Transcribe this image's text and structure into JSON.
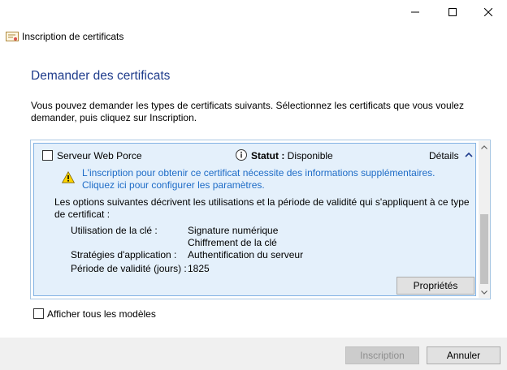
{
  "window": {
    "title": "Inscription de certificats",
    "controls": [
      "minimize-icon",
      "maximize-icon",
      "close-icon"
    ]
  },
  "page": {
    "heading": "Demander des certificats",
    "intro": "Vous pouvez demander les types de certificats suivants. Sélectionnez les certificats que vous voulez demander, puis cliquez sur Inscription."
  },
  "certificate": {
    "name": "Serveur Web Porce",
    "checked": false,
    "status_label": "Statut :",
    "status_value": "Disponible",
    "details_label": "Détails",
    "warning_line1": "L'inscription pour obtenir ce certificat nécessite des informations supplémentaires.",
    "warning_line2": "Cliquez ici pour configurer les paramètres.",
    "description": "Les options suivantes décrivent les utilisations et la période de validité qui s'appliquent à ce type de certificat :",
    "properties": [
      {
        "label": "Utilisation de la clé :",
        "values": [
          "Signature numérique",
          "Chiffrement de la clé"
        ]
      },
      {
        "label": "Stratégies d'application :",
        "values": [
          "Authentification du serveur"
        ]
      },
      {
        "label": "Période de validité (jours) :",
        "values": [
          "1825"
        ]
      }
    ],
    "properties_button": "Propriétés"
  },
  "show_all_templates": {
    "label": "Afficher tous les modèles",
    "checked": false
  },
  "footer": {
    "enroll_button": "Inscription",
    "enroll_enabled": false,
    "cancel_button": "Annuler"
  },
  "colors": {
    "heading": "#1f3c8c",
    "link": "#1e6cc7",
    "item_background": "#e4f0fb",
    "item_border": "#82b2e3"
  }
}
